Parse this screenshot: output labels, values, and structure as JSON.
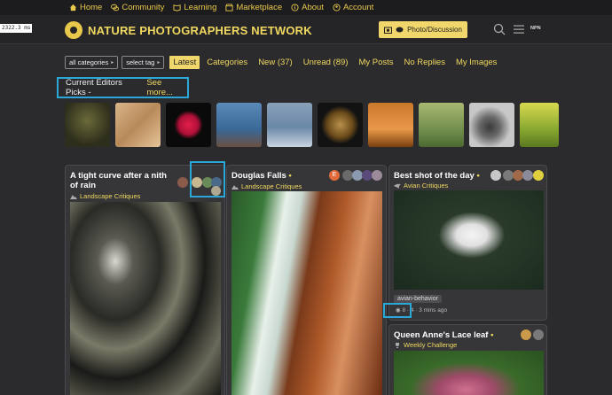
{
  "topnav": {
    "items": [
      {
        "label": "Home",
        "icon": "home-icon"
      },
      {
        "label": "Community",
        "icon": "chat-icon"
      },
      {
        "label": "Learning",
        "icon": "book-icon"
      },
      {
        "label": "Marketplace",
        "icon": "store-icon"
      },
      {
        "label": "About",
        "icon": "info-icon"
      },
      {
        "label": "Account",
        "icon": "user-icon"
      }
    ]
  },
  "timing": "2322.3 ms",
  "header": {
    "site_title": "NATURE PHOTOGRAPHERS NETWORK",
    "photo_button": "Photo/Discussion",
    "avatar_text": "NPN"
  },
  "filters": {
    "category": "all categories",
    "tag": "select tag",
    "tabs": [
      "Latest",
      "Categories",
      "New (37)",
      "Unread (89)",
      "My Posts",
      "No Replies",
      "My Images"
    ]
  },
  "picks": {
    "label": "Current Editors Picks - ",
    "more": "See more..."
  },
  "cards": [
    {
      "title": "A tight curve after a nith of rain",
      "category": "Landscape Critiques"
    },
    {
      "title": "Douglas Falls",
      "category": "Landscape Critiques",
      "avatar_letter": "E"
    },
    {
      "title": "Best shot of the day",
      "category": "Avian Critiques",
      "tag": "avian-behavior",
      "meta": "8 · 4 · 3 mins ago"
    },
    {
      "title": "Queen Anne's Lace leaf",
      "category": "Weekly Challenge"
    }
  ],
  "colors": {
    "accent": "#f0d860",
    "highlight": "#2aa8d8",
    "background": "#2b2b2e"
  }
}
